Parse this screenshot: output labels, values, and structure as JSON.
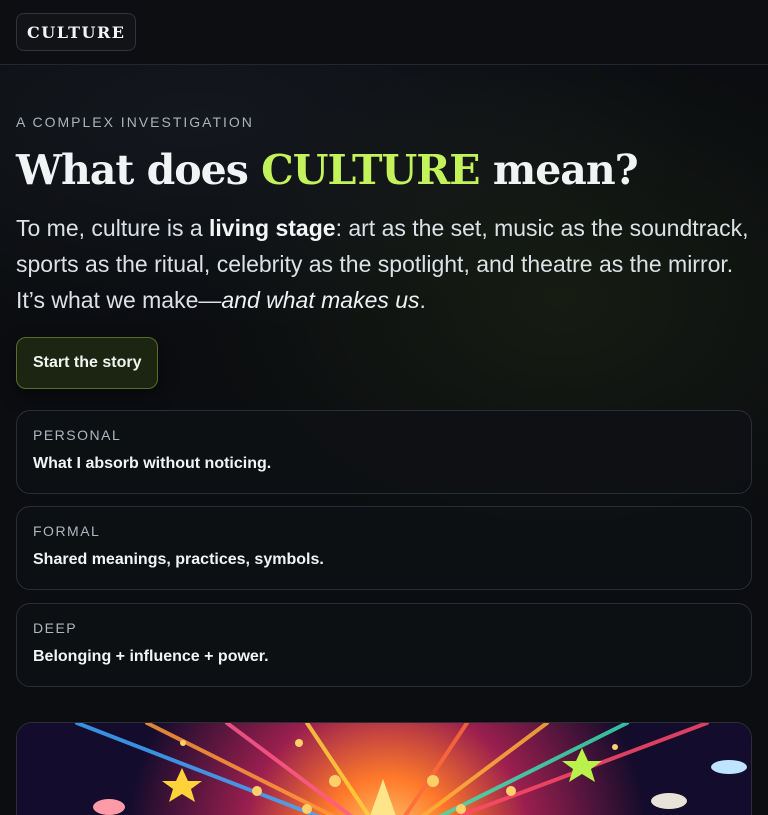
{
  "brand": {
    "logo": "CULTURE"
  },
  "hero": {
    "eyebrow": "A COMPLEX INVESTIGATION",
    "title_pre": "What does ",
    "title_accent": "CULTURE",
    "title_post": " mean?",
    "lead_1": "To me, culture is a ",
    "lead_bold": "living stage",
    "lead_2": ": art as the set, music as the soundtrack, sports as the ritual, celebrity as the spotlight, and theatre as the mirror. It’s what we make—",
    "lead_italic": "and what makes us",
    "lead_end": ".",
    "cta_label": "Start the story"
  },
  "cards": [
    {
      "label": "PERSONAL",
      "text": "What I absorb without noticing."
    },
    {
      "label": "FORMAL",
      "text": "Shared meanings, practices, symbols."
    },
    {
      "label": "DEEP",
      "text": "Belonging + influence + power."
    }
  ],
  "colors": {
    "accent": "#c4f25a",
    "background": "#0b0d10",
    "cta_border": "#5a6b2a"
  },
  "banner": {
    "icon": "illustration-starburst-image"
  }
}
